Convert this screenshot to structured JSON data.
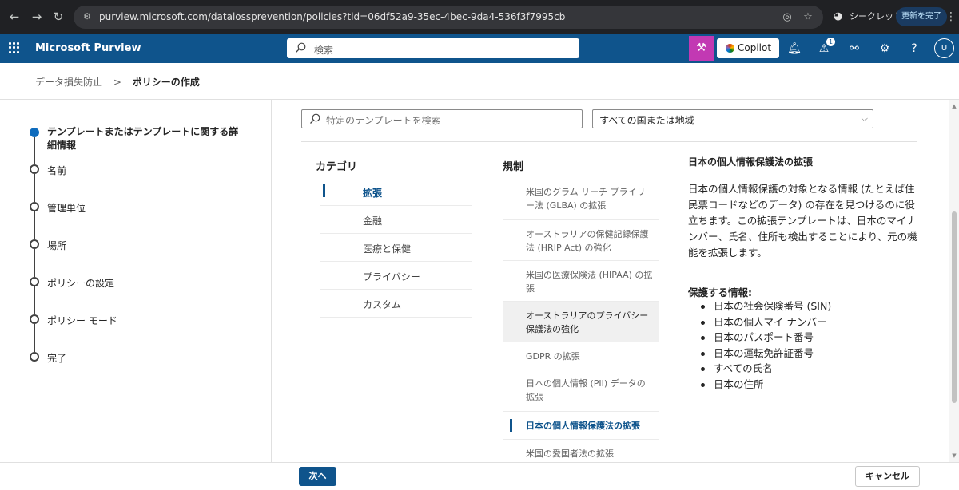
{
  "browser": {
    "url": "purview.microsoft.com/datalossprevention/policies?tid=06df52a9-35ec-4bec-9da4-536f3f7995cb",
    "incognito_label": "シークレット",
    "update_label": "更新を完了"
  },
  "header": {
    "brand": "Microsoft Purview",
    "search_placeholder": "検索",
    "copilot_label": "Copilot",
    "notification_count": "1",
    "avatar_initial": "U",
    "accent_color": "#0f548c",
    "copilot_accent": "#c239b3"
  },
  "breadcrumb": {
    "parent": "データ損失防止",
    "separator": ">",
    "current": "ポリシーの作成"
  },
  "wizard": {
    "steps": [
      {
        "label": "テンプレートまたはテンプレートに関する詳細情報",
        "active": true
      },
      {
        "label": "名前",
        "active": false
      },
      {
        "label": "管理単位",
        "active": false
      },
      {
        "label": "場所",
        "active": false
      },
      {
        "label": "ポリシーの設定",
        "active": false
      },
      {
        "label": "ポリシー モード",
        "active": false
      },
      {
        "label": "完了",
        "active": false
      }
    ]
  },
  "main": {
    "template_search_placeholder": "特定のテンプレートを検索",
    "region_filter_value": "すべての国または地域",
    "categories_title": "カテゴリ",
    "categories": [
      {
        "label": "拡張",
        "selected": true
      },
      {
        "label": "金融",
        "selected": false
      },
      {
        "label": "医療と保健",
        "selected": false
      },
      {
        "label": "プライバシー",
        "selected": false
      },
      {
        "label": "カスタム",
        "selected": false
      }
    ],
    "regulations_title": "規制",
    "regulations": [
      {
        "label": "米国のグラム リーチ ブライリー法 (GLBA) の拡張"
      },
      {
        "label": "オーストラリアの保健記録保護法 (HRIP Act) の強化"
      },
      {
        "label": "米国の医療保険法 (HIPAA) の拡張"
      },
      {
        "label": "オーストラリアのプライバシー保護法の強化"
      },
      {
        "label": "GDPR の拡張"
      },
      {
        "label": "日本の個人情報 (PII) データの拡張"
      },
      {
        "label": "日本の個人情報保護法の拡張"
      },
      {
        "label": "米国の愛国者法の拡張"
      }
    ],
    "detail": {
      "title": "日本の個人情報保護法の拡張",
      "description": "日本の個人情報保護の対象となる情報 (たとえば住民票コードなどのデータ) の存在を見つけるのに役立ちます。この拡張テンプレートは、日本のマイナンバー、氏名、住所も検出することにより、元の機能を拡張します。",
      "protects_title": "保護する情報:",
      "protects": [
        "日本の社会保険番号 (SIN)",
        "日本の個人マイ ナンバー",
        "日本のパスポート番号",
        "日本の運転免許証番号",
        "すべての氏名",
        "日本の住所"
      ]
    }
  },
  "footer": {
    "next_label": "次へ",
    "cancel_label": "キャンセル"
  }
}
